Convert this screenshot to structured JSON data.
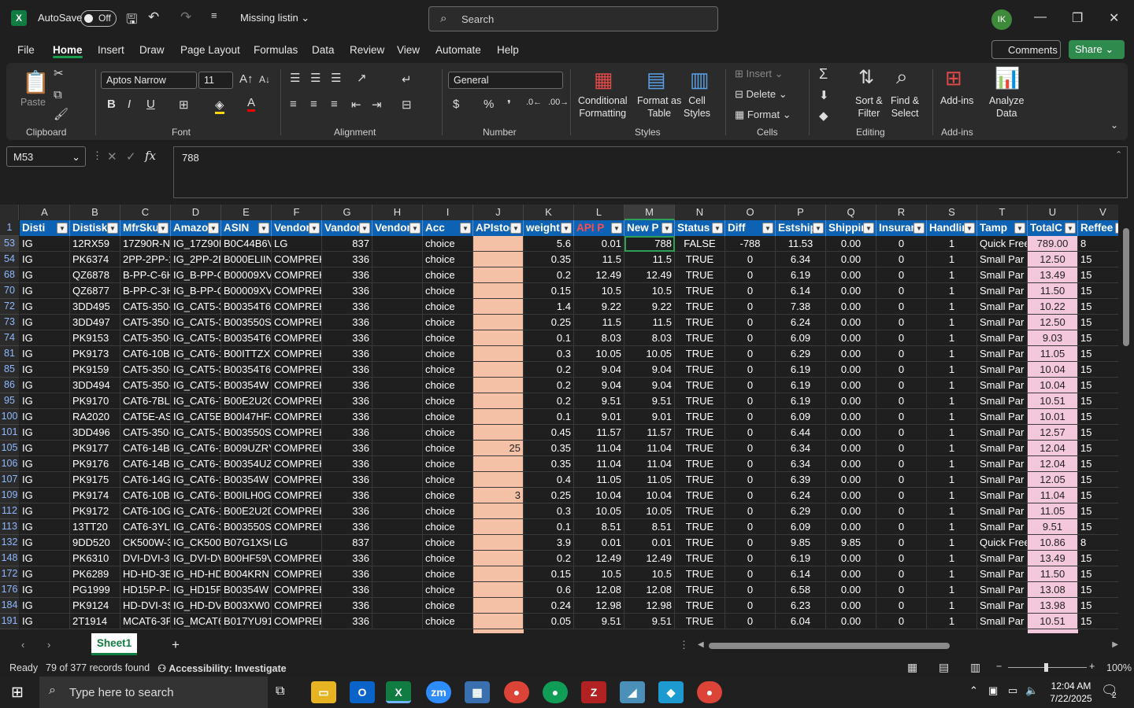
{
  "app": {
    "autosave_label": "AutoSave",
    "autosave_state": "Off",
    "doc_title": "Missing listin",
    "search_placeholder": "Search",
    "user_initials": "IK"
  },
  "menu_tabs": [
    "File",
    "Home",
    "Insert",
    "Draw",
    "Page Layout",
    "Formulas",
    "Data",
    "Review",
    "View",
    "Automate",
    "Help"
  ],
  "comments_label": "Comments",
  "share_label": "Share",
  "ribbon": {
    "clipboard": {
      "label": "Clipboard",
      "paste": "Paste"
    },
    "font": {
      "label": "Font",
      "name": "Aptos Narrow",
      "size": "11"
    },
    "alignment": {
      "label": "Alignment"
    },
    "number": {
      "label": "Number",
      "format": "General"
    },
    "styles": {
      "label": "Styles",
      "conditional": "Conditional\nFormatting",
      "format_table": "Format as\nTable",
      "cell_styles": "Cell\nStyles"
    },
    "cells": {
      "label": "Cells",
      "insert": "Insert",
      "delete": "Delete",
      "format": "Format"
    },
    "editing": {
      "label": "Editing",
      "sort": "Sort &\nFilter",
      "find": "Find &\nSelect"
    },
    "addins": {
      "label": "Add-ins",
      "addins": "Add-ins",
      "analyze": "Analyze\nData"
    }
  },
  "formula_bar": {
    "name_box": "M53",
    "formula": "788"
  },
  "columns": [
    "A",
    "B",
    "C",
    "D",
    "E",
    "F",
    "G",
    "H",
    "I",
    "J",
    "K",
    "L",
    "M",
    "N",
    "O",
    "P",
    "Q",
    "R",
    "S",
    "T",
    "U",
    "V"
  ],
  "header_row_num": "1",
  "headers": [
    "Disti",
    "Distisk",
    "MfrSku",
    "Amazo",
    "ASIN",
    "Vendor",
    "Vandor",
    "Vendor",
    "Acc",
    "APIstoc",
    "weight",
    "API P",
    "New P",
    "Status",
    "Diff",
    "Estship",
    "Shippin",
    "Insuran",
    "Handlin",
    "Tamp",
    "TotalC",
    "Reffee"
  ],
  "rows": [
    {
      "n": "53",
      "v": [
        "IG",
        "12RX59",
        "17Z90R-N.",
        "IG_17Z90R",
        "B0C44B6V",
        "LG",
        "837",
        "",
        "choice",
        "",
        "5.6",
        "0.01",
        "788",
        "FALSE",
        "-788",
        "11.53",
        "0.00",
        "0",
        "1",
        "Quick Free",
        "789.00",
        "8"
      ]
    },
    {
      "n": "54",
      "v": [
        "IG",
        "PK6374",
        "2PP-2PP-1",
        "IG_2PP-2P",
        "B000ELIIN",
        "COMPREH",
        "336",
        "",
        "choice",
        "",
        "0.35",
        "11.5",
        "11.5",
        "TRUE",
        "0",
        "6.34",
        "0.00",
        "0",
        "1",
        "Small Par",
        "12.50",
        "15"
      ]
    },
    {
      "n": "68",
      "v": [
        "IG",
        "QZ6878",
        "B-PP-C-6H",
        "IG_B-PP-C",
        "B00009XV",
        "COMPREH",
        "336",
        "",
        "choice",
        "",
        "0.2",
        "12.49",
        "12.49",
        "TRUE",
        "0",
        "6.19",
        "0.00",
        "0",
        "1",
        "Small Par",
        "13.49",
        "15"
      ]
    },
    {
      "n": "70",
      "v": [
        "IG",
        "QZ6877",
        "B-PP-C-3H",
        "IG_B-PP-C",
        "B00009XV",
        "COMPREH",
        "336",
        "",
        "choice",
        "",
        "0.15",
        "10.5",
        "10.5",
        "TRUE",
        "0",
        "6.14",
        "0.00",
        "0",
        "1",
        "Small Par",
        "11.50",
        "15"
      ]
    },
    {
      "n": "72",
      "v": [
        "IG",
        "3DD495",
        "CAT5-350-",
        "IG_CAT5-3",
        "B00354T6",
        "COMPREH",
        "336",
        "",
        "choice",
        "",
        "1.4",
        "9.22",
        "9.22",
        "TRUE",
        "0",
        "7.38",
        "0.00",
        "0",
        "1",
        "Small Par",
        "10.22",
        "15"
      ]
    },
    {
      "n": "73",
      "v": [
        "IG",
        "3DD497",
        "CAT5-350-",
        "IG_CAT5-3",
        "B003550S",
        "COMPREH",
        "336",
        "",
        "choice",
        "",
        "0.25",
        "11.5",
        "11.5",
        "TRUE",
        "0",
        "6.24",
        "0.00",
        "0",
        "1",
        "Small Par",
        "12.50",
        "15"
      ]
    },
    {
      "n": "74",
      "v": [
        "IG",
        "PK9153",
        "CAT5-350-",
        "IG_CAT5-3",
        "B00354T6",
        "COMPREH",
        "336",
        "",
        "choice",
        "",
        "0.1",
        "8.03",
        "8.03",
        "TRUE",
        "0",
        "6.09",
        "0.00",
        "0",
        "1",
        "Small Par",
        "9.03",
        "15"
      ]
    },
    {
      "n": "81",
      "v": [
        "IG",
        "PK9173",
        "CAT6-10B",
        "IG_CAT6-1",
        "B00ITTZXF",
        "COMPREH",
        "336",
        "",
        "choice",
        "",
        "0.3",
        "10.05",
        "10.05",
        "TRUE",
        "0",
        "6.29",
        "0.00",
        "0",
        "1",
        "Small Par",
        "11.05",
        "15"
      ]
    },
    {
      "n": "85",
      "v": [
        "IG",
        "PK9159",
        "CAT5-350-",
        "IG_CAT5-3",
        "B00354T6",
        "COMPREH",
        "336",
        "",
        "choice",
        "",
        "0.2",
        "9.04",
        "9.04",
        "TRUE",
        "0",
        "6.19",
        "0.00",
        "0",
        "1",
        "Small Par",
        "10.04",
        "15"
      ]
    },
    {
      "n": "86",
      "v": [
        "IG",
        "3DD494",
        "CAT5-350-",
        "IG_CAT5-3",
        "B00354W",
        "COMPREH",
        "336",
        "",
        "choice",
        "",
        "0.2",
        "9.04",
        "9.04",
        "TRUE",
        "0",
        "6.19",
        "0.00",
        "0",
        "1",
        "Small Par",
        "10.04",
        "15"
      ]
    },
    {
      "n": "95",
      "v": [
        "IG",
        "PK9170",
        "CAT6-7BL",
        "IG_CAT6-7",
        "B00E2U2C",
        "COMPREH",
        "336",
        "",
        "choice",
        "",
        "0.2",
        "9.51",
        "9.51",
        "TRUE",
        "0",
        "6.19",
        "0.00",
        "0",
        "1",
        "Small Par",
        "10.51",
        "15"
      ]
    },
    {
      "n": "100",
      "v": [
        "IG",
        "RA2020",
        "CAT5E-AS",
        "IG_CAT5E-",
        "B00I47HF4",
        "COMPREH",
        "336",
        "",
        "choice",
        "",
        "0.1",
        "9.01",
        "9.01",
        "TRUE",
        "0",
        "6.09",
        "0.00",
        "0",
        "1",
        "Small Par",
        "10.01",
        "15"
      ]
    },
    {
      "n": "101",
      "v": [
        "IG",
        "3DD496",
        "CAT5-350-",
        "IG_CAT5-3",
        "B003550S",
        "COMPREH",
        "336",
        "",
        "choice",
        "",
        "0.45",
        "11.57",
        "11.57",
        "TRUE",
        "0",
        "6.44",
        "0.00",
        "0",
        "1",
        "Small Par",
        "12.57",
        "15"
      ]
    },
    {
      "n": "105",
      "v": [
        "IG",
        "PK9177",
        "CAT6-14B",
        "IG_CAT6-1",
        "B009UZRY",
        "COMPREH",
        "336",
        "",
        "choice",
        "25",
        "0.35",
        "11.04",
        "11.04",
        "TRUE",
        "0",
        "6.34",
        "0.00",
        "0",
        "1",
        "Small Par",
        "12.04",
        "15"
      ]
    },
    {
      "n": "106",
      "v": [
        "IG",
        "PK9176",
        "CAT6-14B",
        "IG_CAT6-1",
        "B00354UZ",
        "COMPREH",
        "336",
        "",
        "choice",
        "",
        "0.35",
        "11.04",
        "11.04",
        "TRUE",
        "0",
        "6.34",
        "0.00",
        "0",
        "1",
        "Small Par",
        "12.04",
        "15"
      ]
    },
    {
      "n": "107",
      "v": [
        "IG",
        "PK9175",
        "CAT6-14G",
        "IG_CAT6-1",
        "B00354W",
        "COMPREH",
        "336",
        "",
        "choice",
        "",
        "0.4",
        "11.05",
        "11.05",
        "TRUE",
        "0",
        "6.39",
        "0.00",
        "0",
        "1",
        "Small Par",
        "12.05",
        "15"
      ]
    },
    {
      "n": "109",
      "v": [
        "IG",
        "PK9174",
        "CAT6-10B",
        "IG_CAT6-1",
        "B00ILH0G",
        "COMPREH",
        "336",
        "",
        "choice",
        "3",
        "0.25",
        "10.04",
        "10.04",
        "TRUE",
        "0",
        "6.24",
        "0.00",
        "0",
        "1",
        "Small Par",
        "11.04",
        "15"
      ]
    },
    {
      "n": "112",
      "v": [
        "IG",
        "PK9172",
        "CAT6-10G",
        "IG_CAT6-1",
        "B00E2U2D",
        "COMPREH",
        "336",
        "",
        "choice",
        "",
        "0.3",
        "10.05",
        "10.05",
        "TRUE",
        "0",
        "6.29",
        "0.00",
        "0",
        "1",
        "Small Par",
        "11.05",
        "15"
      ]
    },
    {
      "n": "113",
      "v": [
        "IG",
        "13TT20",
        "CAT6-3YL",
        "IG_CAT6-3",
        "B003550S",
        "COMPREH",
        "336",
        "",
        "choice",
        "",
        "0.1",
        "8.51",
        "8.51",
        "TRUE",
        "0",
        "6.09",
        "0.00",
        "0",
        "1",
        "Small Par",
        "9.51",
        "15"
      ]
    },
    {
      "n": "132",
      "v": [
        "IG",
        "9DD520",
        "CK500W-3",
        "IG_CK500V",
        "B07G1XSC",
        "LG",
        "837",
        "",
        "choice",
        "",
        "3.9",
        "0.01",
        "0.01",
        "TRUE",
        "0",
        "9.85",
        "9.85",
        "0",
        "1",
        "Quick Free",
        "10.86",
        "8"
      ]
    },
    {
      "n": "148",
      "v": [
        "IG",
        "PK6310",
        "DVI-DVI-3",
        "IG_DVI-DV",
        "B00HF59V",
        "COMPREH",
        "336",
        "",
        "choice",
        "",
        "0.2",
        "12.49",
        "12.49",
        "TRUE",
        "0",
        "6.19",
        "0.00",
        "0",
        "1",
        "Small Par",
        "13.49",
        "15"
      ]
    },
    {
      "n": "172",
      "v": [
        "IG",
        "PK6289",
        "HD-HD-3E",
        "IG_HD-HD",
        "B004KRN",
        "COMPREH",
        "336",
        "",
        "choice",
        "",
        "0.15",
        "10.5",
        "10.5",
        "TRUE",
        "0",
        "6.14",
        "0.00",
        "0",
        "1",
        "Small Par",
        "11.50",
        "15"
      ]
    },
    {
      "n": "176",
      "v": [
        "IG",
        "PG1999",
        "HD15P-P-6",
        "IG_HD15P",
        "B00354W",
        "COMPREH",
        "336",
        "",
        "choice",
        "",
        "0.6",
        "12.08",
        "12.08",
        "TRUE",
        "0",
        "6.58",
        "0.00",
        "0",
        "1",
        "Small Par",
        "13.08",
        "15"
      ]
    },
    {
      "n": "184",
      "v": [
        "IG",
        "PK9124",
        "HD-DVI-3S",
        "IG_HD-DV",
        "B003XW0",
        "COMPREH",
        "336",
        "",
        "choice",
        "",
        "0.24",
        "12.98",
        "12.98",
        "TRUE",
        "0",
        "6.23",
        "0.00",
        "0",
        "1",
        "Small Par",
        "13.98",
        "15"
      ]
    },
    {
      "n": "191",
      "v": [
        "IG",
        "2T1914",
        "MCAT6-3P",
        "IG_MCAT6",
        "B017YU91",
        "COMPREH",
        "336",
        "",
        "choice",
        "",
        "0.05",
        "9.51",
        "9.51",
        "TRUE",
        "0",
        "6.04",
        "0.00",
        "0",
        "1",
        "Small Par",
        "10.51",
        "15"
      ]
    }
  ],
  "sheet_tab": "Sheet1",
  "status": {
    "ready": "Ready",
    "records": "79 of 377 records found",
    "accessibility": "Accessibility: Investigate",
    "zoom": "100%"
  },
  "taskbar": {
    "search_placeholder": "Type here to search",
    "time": "12:04 AM",
    "date": "7/22/2025",
    "notif_count": "2"
  }
}
